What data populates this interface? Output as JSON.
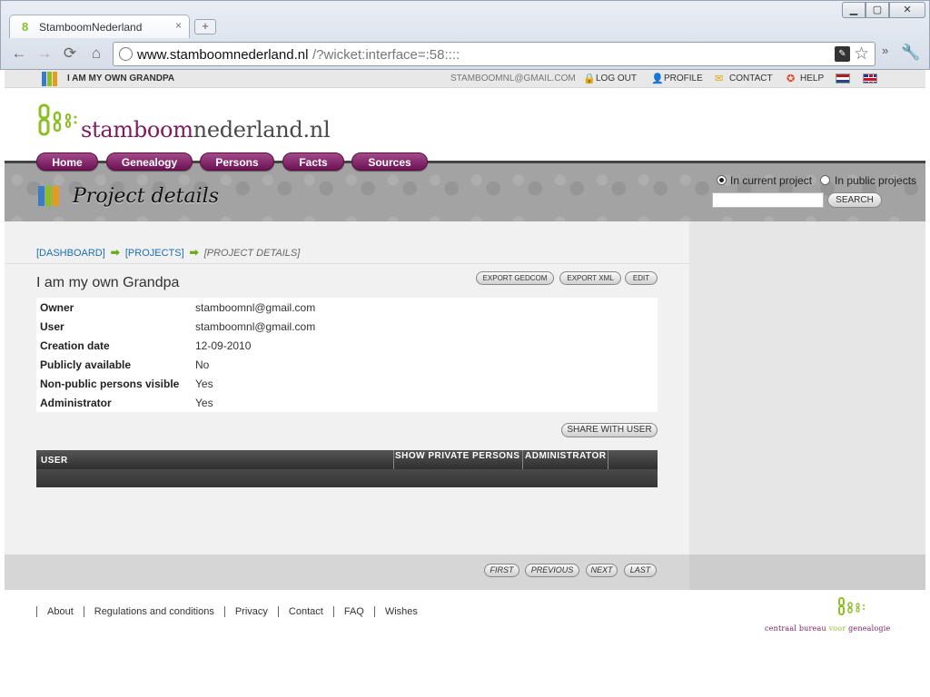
{
  "browser": {
    "tab_title": "StamboomNederland",
    "tab_close": "×",
    "new_tab": "+",
    "url_host": "www.stamboomnederland.nl",
    "url_path": "/?wicket:interface=:58::::",
    "window_buttons": {
      "minimize": "▁",
      "maximize": "▢",
      "close": "✕"
    },
    "nav": {
      "back": "←",
      "forward": "→",
      "reload": "⟳",
      "home": "⌂"
    },
    "more": "»"
  },
  "topbar": {
    "project": "I AM MY OWN GRANDPA",
    "email": "STAMBOOMNL@GMAIL.COM",
    "logout": "LOG OUT",
    "profile": "PROFILE",
    "contact": "CONTACT",
    "help": "HELP"
  },
  "logo": {
    "part1": "stamboom",
    "part2": "nederland.nl"
  },
  "nav": [
    {
      "label": "Home"
    },
    {
      "label": "Genealogy"
    },
    {
      "label": "Persons"
    },
    {
      "label": "Facts"
    },
    {
      "label": "Sources"
    }
  ],
  "banner": {
    "heading": "Project details",
    "radio_current": "In current project",
    "radio_public": "In public projects",
    "search_value": "",
    "search_button": "SEARCH"
  },
  "breadcrumb": {
    "dashboard": "[DASHBOARD]",
    "projects": "[PROJECTS]",
    "current": "[PROJECT DETAILS]"
  },
  "project": {
    "title": "I am my own Grandpa",
    "buttons": {
      "export_gedcom": "EXPORT GEDCOM",
      "export_xml": "EXPORT XML",
      "edit": "EDIT"
    },
    "details": [
      {
        "label": "Owner",
        "value": "stamboomnl@gmail.com"
      },
      {
        "label": "User",
        "value": "stamboomnl@gmail.com"
      },
      {
        "label": "Creation date",
        "value": "12-09-2010"
      },
      {
        "label": "Publicly available",
        "value": "No"
      },
      {
        "label": "Non-public persons visible",
        "value": "Yes"
      },
      {
        "label": "Administrator",
        "value": "Yes"
      }
    ],
    "share_button": "SHARE WITH USER"
  },
  "users_table": {
    "headers": [
      "USER",
      "SHOW PRIVATE PERSONS",
      "ADMINISTRATOR",
      ""
    ]
  },
  "pager": {
    "first": "FIRST",
    "previous": "PREVIOUS",
    "next": "NEXT",
    "last": "LAST"
  },
  "footer": {
    "links": [
      "About",
      "Regulations and conditions",
      "Privacy",
      "Contact",
      "FAQ",
      "Wishes"
    ],
    "cbg_part1": "centraal bureau",
    "cbg_part2": "voor",
    "cbg_part3": "genealogie"
  },
  "colors": {
    "brand_purple": "#7b1c5c",
    "brand_green": "#8cbf26",
    "link_blue": "#1a6fb0"
  }
}
